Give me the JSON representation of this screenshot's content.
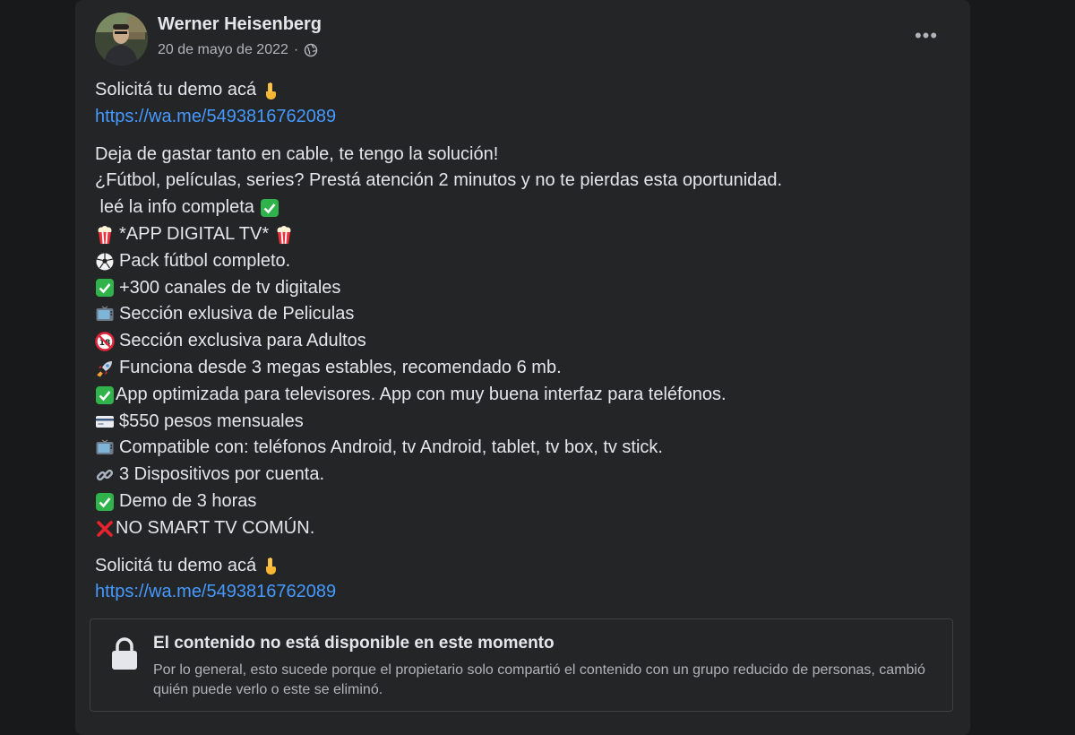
{
  "post": {
    "author": "Werner Heisenberg",
    "date": "20 de mayo de 2022",
    "separator": "·",
    "more_label": "•••",
    "lines": [
      {
        "icon": "",
        "text": "Solicitá tu demo acá",
        "icon_after": "pointing-down-emoji"
      },
      {
        "icon": "",
        "text": "https://wa.me/5493816762089",
        "link": true
      },
      {
        "gap": true
      },
      {
        "icon": "",
        "text": "Deja de gastar tanto en cable, te tengo la solución!"
      },
      {
        "icon": "",
        "text": "¿Fútbol, películas, series? Prestá atención 2 minutos y no te pierdas esta oportunidad."
      },
      {
        "icon": "",
        "text": " leé la info completa",
        "icon_after": "check-mark-emoji"
      },
      {
        "icon": "popcorn-emoji",
        "text": "*APP DIGITAL TV*",
        "icon_after": "popcorn-emoji"
      },
      {
        "icon": "soccer-ball-emoji",
        "text": "Pack fútbol completo."
      },
      {
        "icon": "check-mark-emoji",
        "text": "+300 canales de tv digitales"
      },
      {
        "icon": "tv-emoji",
        "text": "Sección exlusiva de Peliculas"
      },
      {
        "icon": "no-under-18-emoji",
        "text": "Sección exclusiva para Adultos"
      },
      {
        "icon": "rocket-emoji",
        "text": "Funciona desde 3 megas estables, recomendado 6 mb."
      },
      {
        "icon": "check-mark-emoji",
        "text": "App optimizada para televisores. App con muy buena interfaz para teléfonos.",
        "tight": true
      },
      {
        "icon": "credit-card-emoji",
        "text": "$550 pesos mensuales"
      },
      {
        "icon": "tv-emoji",
        "text": "Compatible con: teléfonos Android, tv Android, tablet, tv box, tv stick."
      },
      {
        "icon": "link-emoji",
        "text": "3 Dispositivos por cuenta."
      },
      {
        "icon": "check-mark-emoji",
        "text": "Demo de 3 horas"
      },
      {
        "icon": "cross-mark-emoji",
        "text": "NO SMART TV COMÚN.",
        "tight": true
      },
      {
        "gap": true
      },
      {
        "icon": "",
        "text": "Solicitá tu demo acá",
        "icon_after": "pointing-down-emoji"
      },
      {
        "icon": "",
        "text": "https://wa.me/5493816762089",
        "link": true
      }
    ]
  },
  "unavailable": {
    "title": "El contenido no está disponible en este momento",
    "description": "Por lo general, esto sucede porque el propietario solo compartió el contenido con un grupo reducido de personas, cambió quién puede verlo o este se eliminó."
  },
  "colors": {
    "page_bg": "#18191a",
    "card_bg": "#242526",
    "text_primary": "#e4e6eb",
    "text_secondary": "#b0b3b8",
    "link": "#4599ff",
    "check_green": "#30b34a"
  }
}
